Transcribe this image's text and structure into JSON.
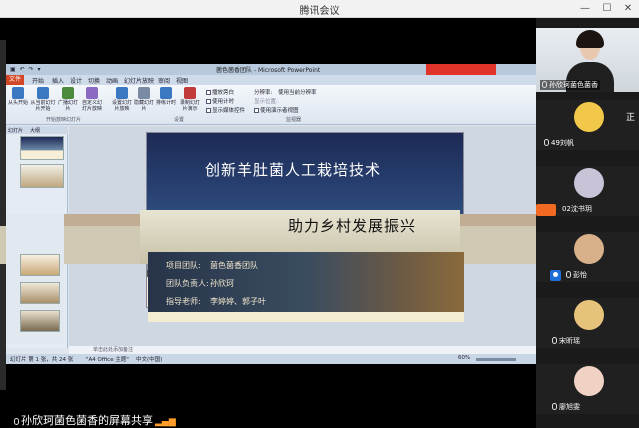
{
  "window": {
    "title": "腾讯会议",
    "controls": {
      "minimize": "—",
      "maximize": "☐",
      "close": "✕"
    }
  },
  "ppt": {
    "quick_access": "▣ ↶ ↷ ▾",
    "document_title": "菌色菌香团队 - Microsoft PowerPoint",
    "tabs": [
      "开始",
      "插入",
      "设计",
      "切换",
      "动画",
      "幻灯片放映",
      "审阅",
      "视图"
    ],
    "file_tab": "文件",
    "ribbon_buttons": [
      {
        "label": "从头开始",
        "icon": "slideshow-start-icon",
        "color": "#3a78c2"
      },
      {
        "label": "从当前幻灯片开始",
        "icon": "slideshow-current-icon",
        "color": "#3a78c2"
      },
      {
        "label": "广播幻灯片",
        "icon": "broadcast-icon",
        "color": "#4a8a3a"
      },
      {
        "label": "自定义幻灯片放映",
        "icon": "custom-show-icon",
        "color": "#8a6ac2"
      },
      {
        "label": "设置幻灯片放映",
        "icon": "setup-show-icon",
        "color": "#3a78c2"
      },
      {
        "label": "隐藏幻灯片",
        "icon": "hide-slide-icon",
        "color": "#7a8aa2"
      },
      {
        "label": "排练计时",
        "icon": "rehearse-icon",
        "color": "#3a78c2"
      },
      {
        "label": "录制幻灯片演示",
        "icon": "record-icon",
        "color": "#c23a3a"
      }
    ],
    "ribbon_checks": [
      "播放旁白",
      "使用计时",
      "显示媒体控件"
    ],
    "ribbon_monitor": [
      "分辨率:",
      "使用当前分辨率",
      "显示位置:",
      "使用演示者视图"
    ],
    "groups": [
      "开始放映幻灯片",
      "设置",
      "监视器"
    ],
    "pane_tabs": [
      "幻灯片",
      "大纲"
    ],
    "slide_title": "创新羊肚菌人工栽培技术",
    "slide_subtitle": "助力乡村发展振兴",
    "slide_lines": [
      {
        "label": "项目团队:",
        "value": "菌色菌香团队"
      },
      {
        "label": "团队负责人:",
        "value": "孙欣珂"
      },
      {
        "label": "指导老师:",
        "value": "李婷婷、郭子叶"
      }
    ],
    "notes_placeholder": "单击此处添加备注",
    "status": {
      "slide_pos": "幻灯片 第 1 张，共 24 张",
      "theme": "\"A4 Office 主题\"",
      "lang": "中文(中国)",
      "zoom": "60%"
    }
  },
  "share_label": "孙欣珂菌色菌香的屏幕共享",
  "participants": [
    {
      "name": "孙欣珂菌色菌香",
      "kind": "video"
    },
    {
      "name": "49刘帆",
      "kind": "avatar",
      "color": "#f1c84a"
    },
    {
      "name": "02沈书玥",
      "kind": "avatar",
      "color": "#c9c3d8"
    },
    {
      "name": "彭怡",
      "kind": "avatar",
      "color": "#d8b08a"
    },
    {
      "name": "宋昕瑶",
      "kind": "avatar",
      "color": "#e6c27a"
    },
    {
      "name": "廖旭雯",
      "kind": "avatar",
      "color": "#f0d2c4"
    }
  ],
  "overflow_name": "正"
}
